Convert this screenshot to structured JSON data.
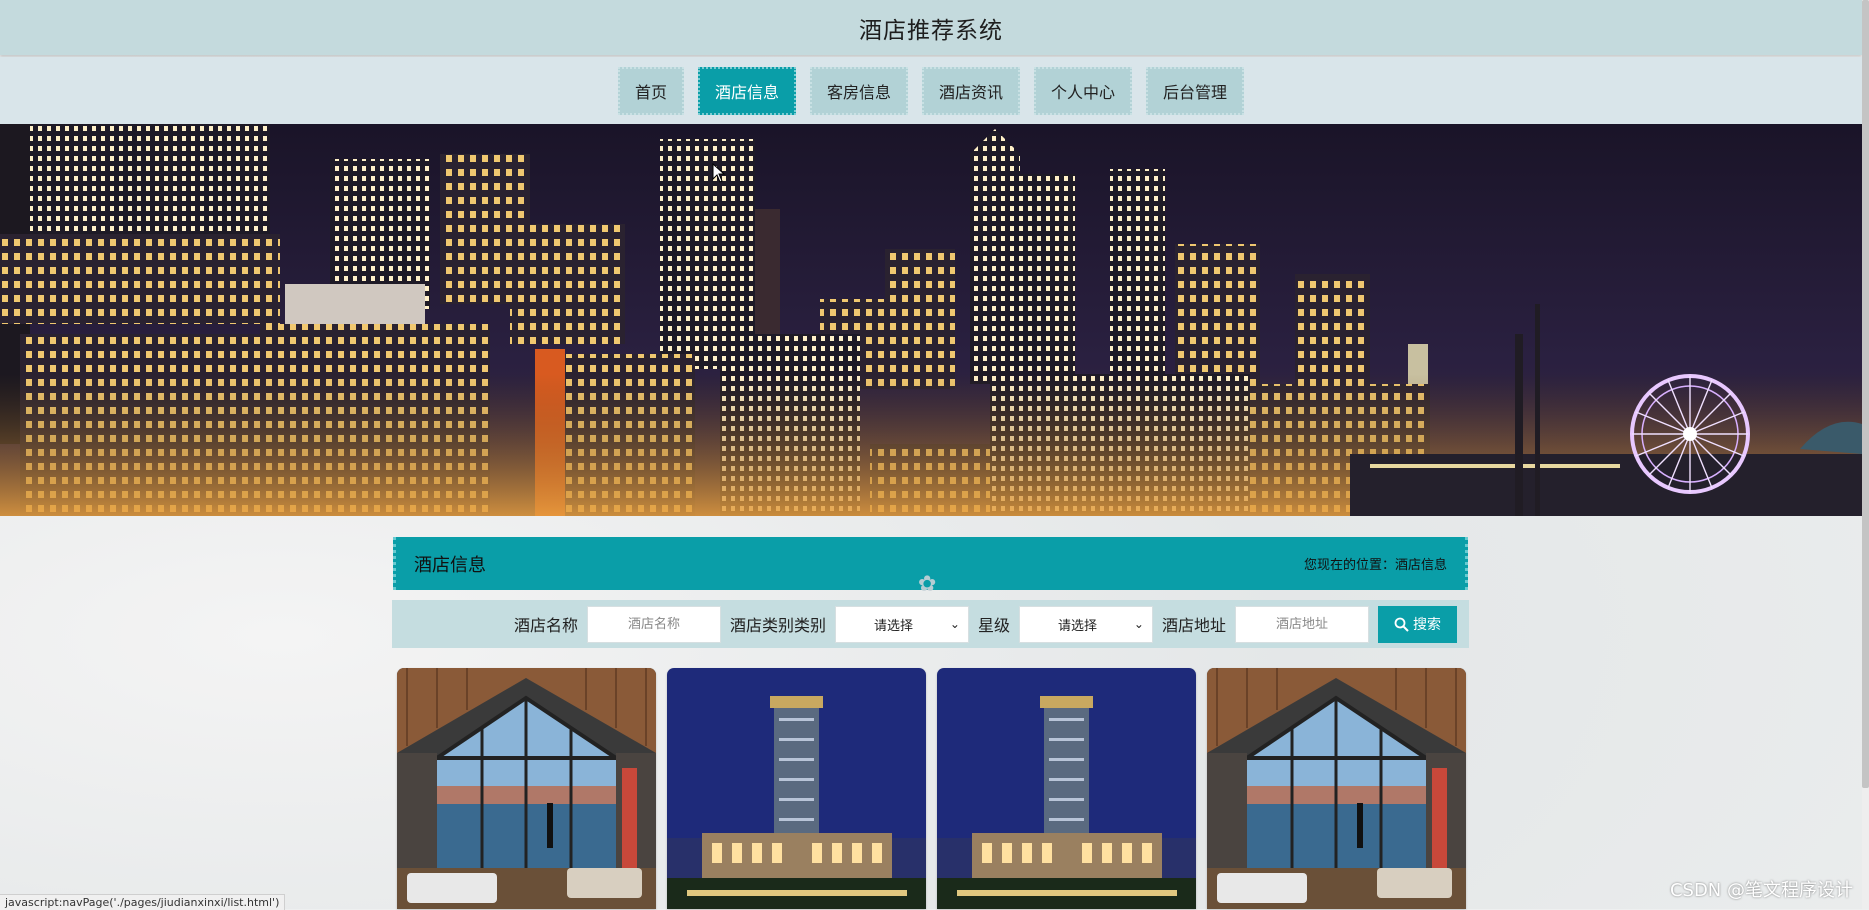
{
  "site": {
    "title": "酒店推荐系统"
  },
  "nav": {
    "items": [
      {
        "label": "首页",
        "active": false
      },
      {
        "label": "酒店信息",
        "active": true
      },
      {
        "label": "客房信息",
        "active": false
      },
      {
        "label": "酒店资讯",
        "active": false
      },
      {
        "label": "个人中心",
        "active": false
      },
      {
        "label": "后台管理",
        "active": false
      }
    ]
  },
  "section": {
    "title": "酒店信息",
    "breadcrumb": "您现在的位置：酒店信息"
  },
  "search": {
    "name_label": "酒店名称",
    "name_placeholder": "酒店名称",
    "category_label": "酒店类别类别",
    "category_value": "请选择",
    "star_label": "星级",
    "star_value": "请选择",
    "address_label": "酒店地址",
    "address_placeholder": "酒店地址",
    "button_label": "搜索"
  },
  "cards": [
    {
      "image": "hotel-room-view"
    },
    {
      "image": "hotel-tower-night"
    },
    {
      "image": "hotel-tower-night"
    },
    {
      "image": "hotel-room-view"
    }
  ],
  "status": {
    "text": "javascript:navPage('./pages/jiudianxinxi/list.html')"
  },
  "watermark": {
    "text": "CSDN @笔文程序设计"
  },
  "colors": {
    "accent": "#0a9ea8",
    "topbar": "#c4dadd",
    "nav_bg": "#d9e5ea",
    "nav_item": "#b2d2d6"
  }
}
